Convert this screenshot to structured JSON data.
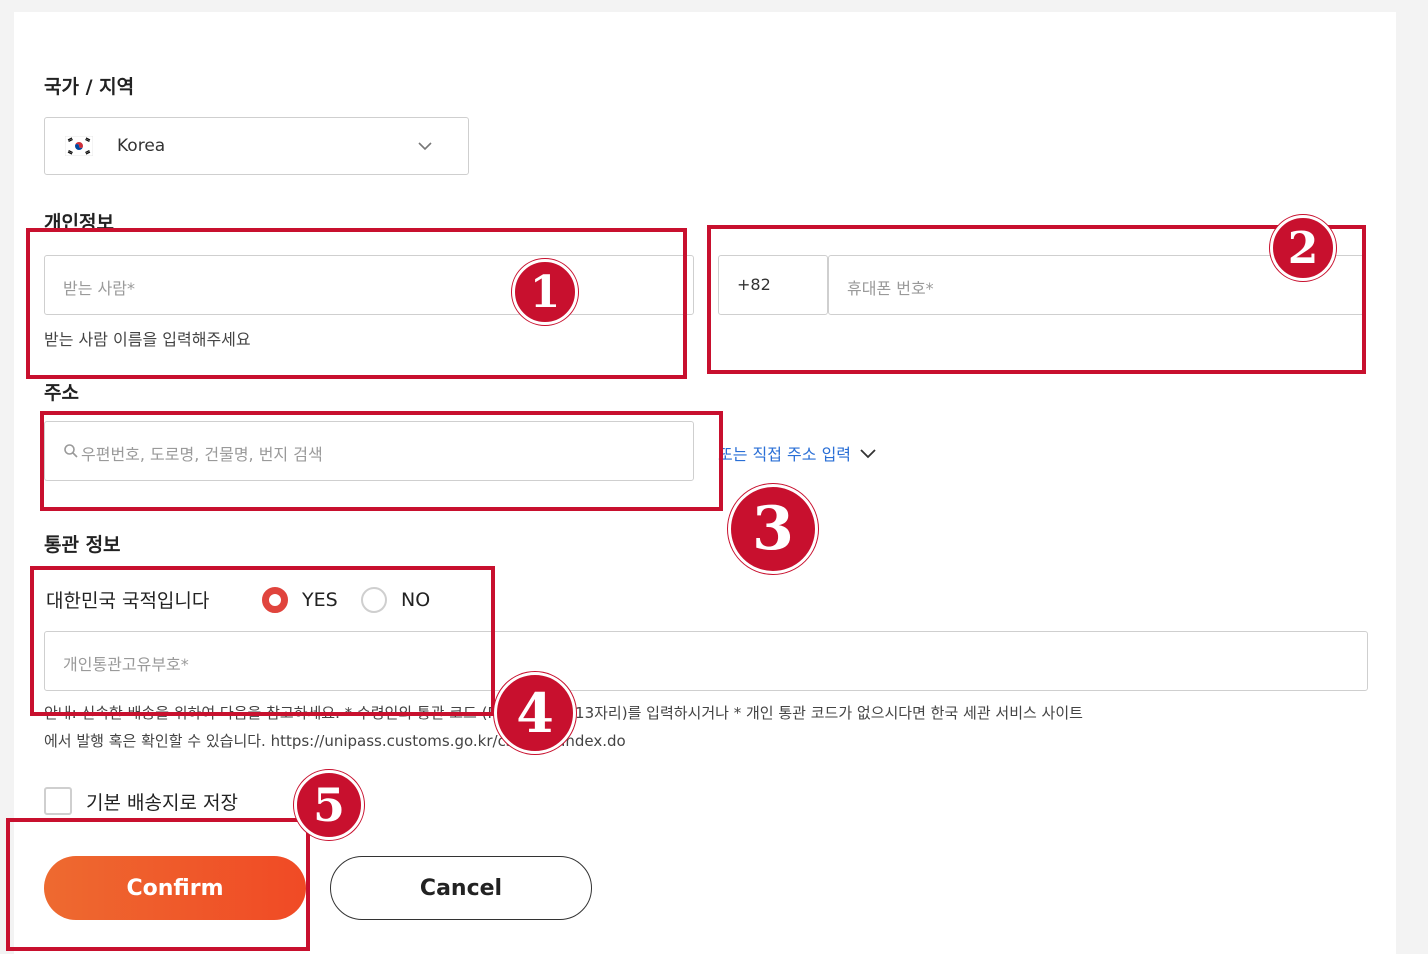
{
  "country_section": {
    "title": "국가 / 지역",
    "selected_country": "Korea",
    "flag_icon": "korea-flag-icon"
  },
  "personal_section": {
    "title": "개인정보",
    "recipient_placeholder": "받는 사람*",
    "recipient_helper": "받는 사람 이름을 입력해주세요",
    "phone_code": "+82",
    "phone_placeholder": "휴대폰 번호*"
  },
  "address_section": {
    "title": "주소",
    "search_placeholder": "우편번호, 도로명, 건물명, 번지 검색",
    "manual_link": "또는 직접 주소 입력"
  },
  "customs_section": {
    "title": "통관 정보",
    "nationality_label": "대한민국 국적입니다",
    "yes_label": "YES",
    "no_label": "NO",
    "customs_code_placeholder": "개인통관고유부호*",
    "notice_line1": "안내: 신속한 배송을 위하여 다음을 참고하세요. * 수령인의 통관 코드 (P로 시작하는 13자리)를 입력하시거나 * 개인 통관 코드가 없으시다면 한국 세관 서비스 사이트",
    "notice_line2": "에서 발행 혹은 확인할 수 있습니다. https://unipass.customs.go.kr/csp/persIndex.do"
  },
  "save_default_label": "기본 배송지로 저장",
  "buttons": {
    "confirm": "Confirm",
    "cancel": "Cancel"
  },
  "annotations": {
    "badge1": "1",
    "badge2": "2",
    "badge3": "3",
    "badge4": "4",
    "badge5": "5"
  },
  "colors": {
    "highlight_red": "#c8102e",
    "confirm_gradient_start": "#ee6a30",
    "confirm_gradient_end": "#f04a25",
    "radio_selected": "#e0443d",
    "link_blue": "#2a6fd6"
  }
}
